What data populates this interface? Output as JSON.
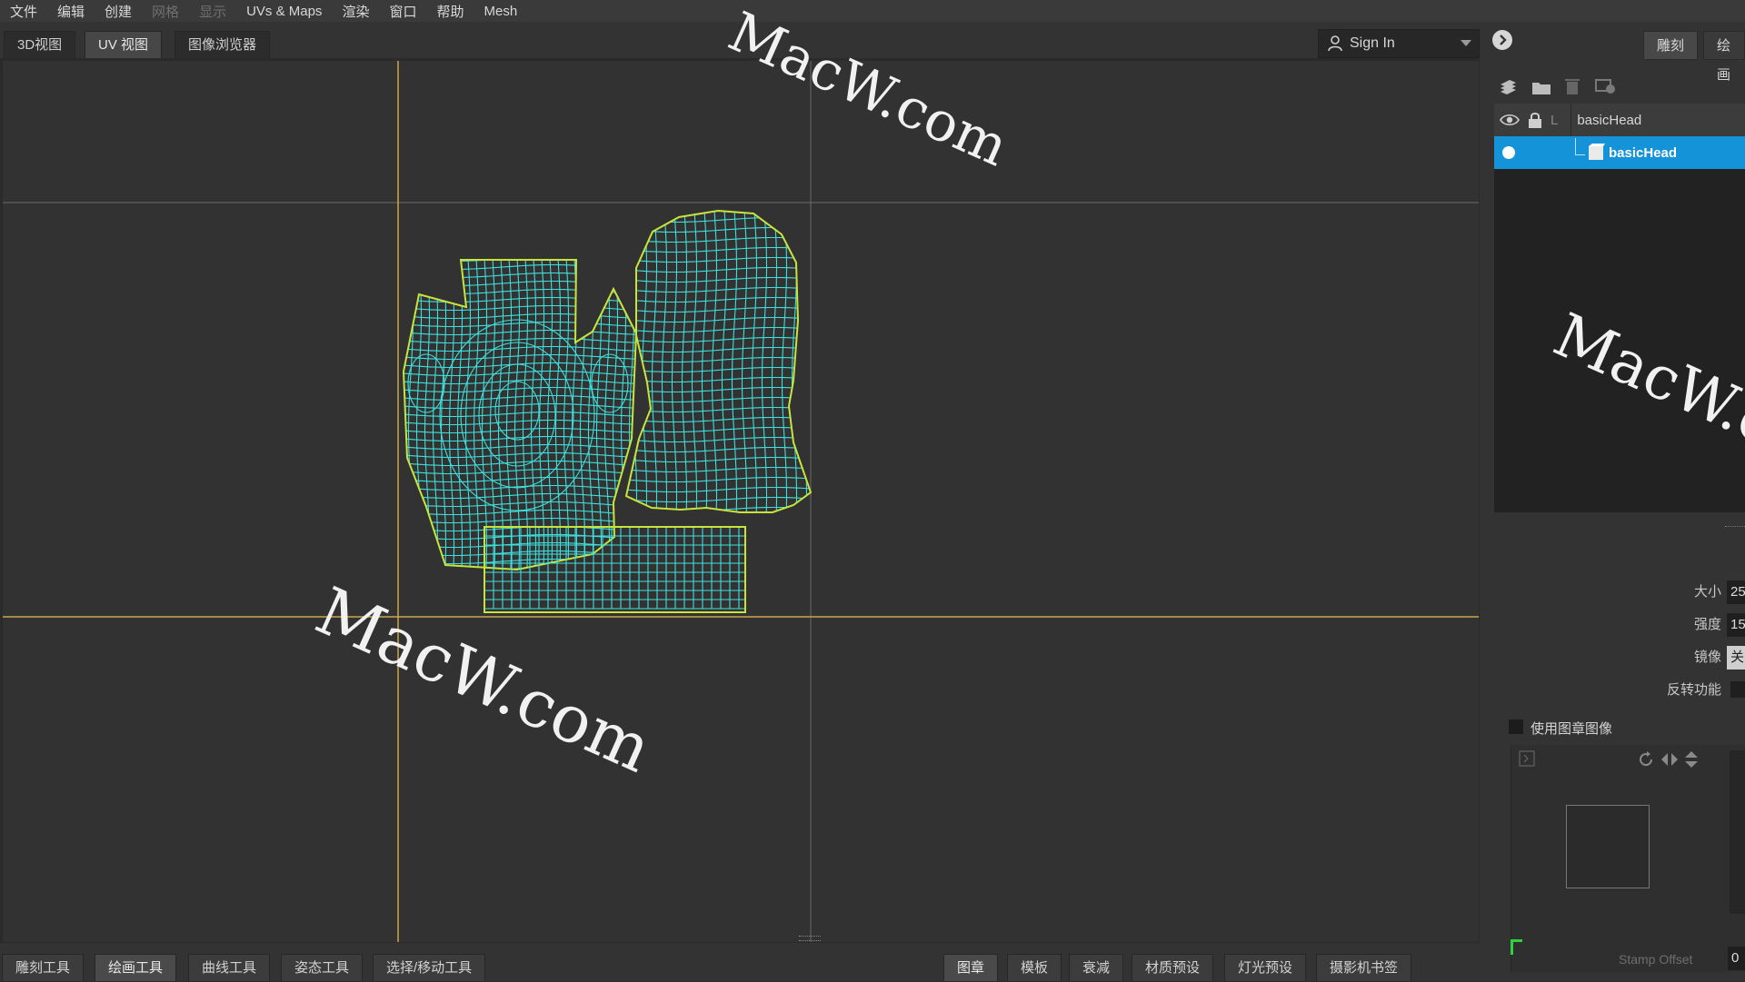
{
  "menu": [
    "文件",
    "编辑",
    "创建",
    "网格",
    "显示",
    "UVs & Maps",
    "渲染",
    "窗口",
    "帮助",
    "Mesh"
  ],
  "menu_disabled": [
    false,
    false,
    false,
    true,
    true,
    false,
    false,
    false,
    false,
    false
  ],
  "tabs": [
    "3D视图",
    "UV 视图",
    "图像浏览器"
  ],
  "signin": {
    "label": "Sign In"
  },
  "right_tabs": [
    "雕刻",
    "绘画"
  ],
  "layers": [
    {
      "letter": "L",
      "name": "basicHead"
    },
    {
      "name": "basicHead"
    }
  ],
  "properties": [
    {
      "label": "大小",
      "value": "25"
    },
    {
      "label": "强度",
      "value": "15"
    },
    {
      "label": "镜像",
      "value": "关"
    },
    {
      "label": "反转功能",
      "value": ""
    }
  ],
  "stamp": {
    "checkbox_label": "使用图章图像",
    "offset_label": "Stamp Offset",
    "offset_value": "0"
  },
  "bottom_left_tabs": [
    "雕刻工具",
    "绘画工具",
    "曲线工具",
    "姿态工具",
    "选择/移动工具"
  ],
  "bottom_right_tabs": [
    "图章",
    "模板",
    "衰减",
    "材质预设",
    "灯光预设",
    "摄影机书签"
  ],
  "watermark": "MacW.com",
  "colors": {
    "uv_wire": "#3fe0dc",
    "uv_border": "#c8e43c",
    "selection": "#1493d8",
    "guide_line": "#c9a84a"
  }
}
